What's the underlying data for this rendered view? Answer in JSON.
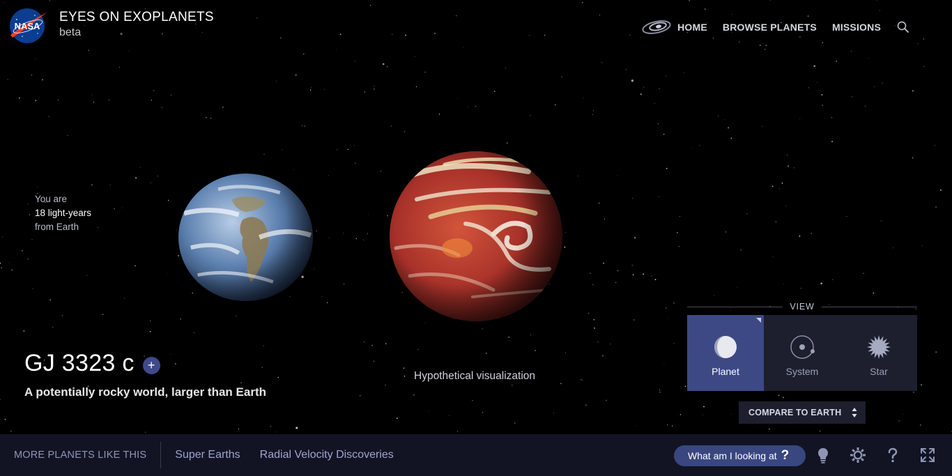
{
  "header": {
    "logo_text": "NASA",
    "title": "EYES ON EXOPLANETS",
    "subtitle": "beta",
    "nav": [
      {
        "label": "HOME",
        "icon": "galaxy-icon"
      },
      {
        "label": "BROWSE PLANETS"
      },
      {
        "label": "MISSIONS"
      }
    ],
    "search_icon": "search-icon"
  },
  "distance": {
    "line1": "You are",
    "line2": "18 light-years",
    "line3": "from Earth"
  },
  "planet": {
    "name": "GJ 3323 c",
    "plus_label": "+",
    "description": "A potentially rocky world, larger than Earth",
    "visual_note": "Hypothetical visualization"
  },
  "view": {
    "label": "VIEW",
    "items": [
      {
        "label": "Planet",
        "icon": "planet-icon",
        "active": true
      },
      {
        "label": "System",
        "icon": "system-icon",
        "active": false
      },
      {
        "label": "Star",
        "icon": "star-icon",
        "active": false
      }
    ],
    "compare_label": "COMPARE TO EARTH"
  },
  "bottom": {
    "more_label": "MORE PLANETS LIKE THIS",
    "tags": [
      "Super Earths",
      "Radial Velocity Discoveries"
    ],
    "looking_label": "What am I looking at",
    "looking_q": "?",
    "controls": [
      "lightbulb-icon",
      "gear-icon",
      "help-icon",
      "fullscreen-icon"
    ]
  },
  "colors": {
    "accent": "#3d4985",
    "panel": "#1d1f2e",
    "bottom_bar": "#121424",
    "link": "#9fa6cc"
  }
}
